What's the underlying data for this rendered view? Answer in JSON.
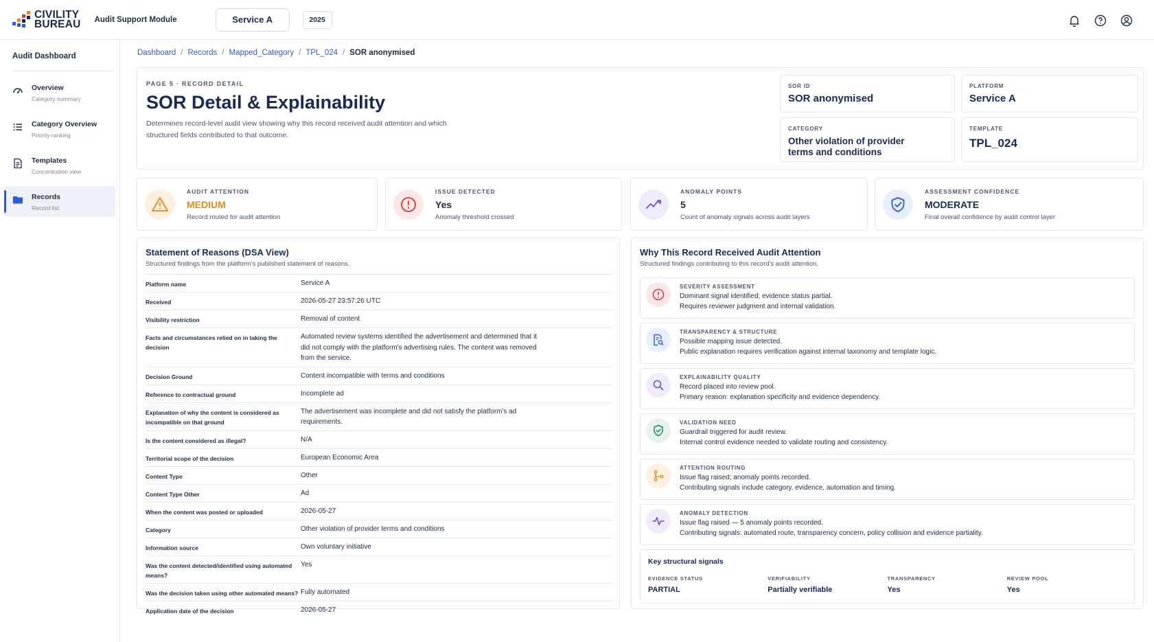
{
  "brand": {
    "line1": "CIVILITY",
    "line2": "BUREAU",
    "module": "Audit Support Module"
  },
  "topbar": {
    "service": "Service A",
    "year": "2025",
    "icons": [
      "bell-icon",
      "help-icon",
      "user-icon"
    ]
  },
  "sidebar": {
    "title": "Audit Dashboard",
    "items": [
      {
        "label": "Overview",
        "sub": "Category summary",
        "icon": "gauge-icon"
      },
      {
        "label": "Category Overview",
        "sub": "Priority ranking",
        "icon": "list-icon"
      },
      {
        "label": "Templates",
        "sub": "Concentration view",
        "icon": "document-icon"
      },
      {
        "label": "Records",
        "sub": "Record list",
        "icon": "folder-icon"
      }
    ]
  },
  "breadcrumb": [
    "Dashboard",
    "Records",
    "Mapped_Category",
    "TPL_024",
    "SOR anonymised"
  ],
  "header": {
    "eyebrow": "PAGE 5 · RECORD DETAIL",
    "title": "SOR Detail & Explainability",
    "description": "Determines record-level audit view showing why this record received audit attention and which structured fields contributed to that outcome.",
    "meta": {
      "sor_id_label": "SOR ID",
      "sor_id": "SOR anonymised",
      "platform_label": "PLATFORM",
      "platform": "Service A",
      "category_label": "CATEGORY",
      "category": "Other violation of provider terms and conditions",
      "template_label": "TEMPLATE",
      "template": "TPL_024"
    }
  },
  "stats": [
    {
      "label": "AUDIT ATTENTION",
      "value": "MEDIUM",
      "desc": "Record routed for audit attention",
      "icon": "warning-icon",
      "color": "#e58a1f"
    },
    {
      "label": "ISSUE DETECTED",
      "value": "Yes",
      "desc": "Anomaly threshold crossed",
      "icon": "alert-circle-icon",
      "color": "#d23b3b"
    },
    {
      "label": "ANOMALY POINTS",
      "value": "5",
      "desc": "Count of anomaly signals across audit layers",
      "icon": "trend-icon",
      "color": "#6b4fcf"
    },
    {
      "label": "ASSESSMENT CONFIDENCE",
      "value": "MODERATE",
      "desc": "Final overall confidence by audit control layer",
      "icon": "shield-check-icon",
      "color": "#2d5bd2"
    }
  ],
  "sor": {
    "title": "Statement of Reasons (DSA View)",
    "subtitle": "Structured findings from the platform's published statement of reasons.",
    "rows": [
      {
        "k": "Platform name",
        "v": "Service A"
      },
      {
        "k": "Received",
        "v": "2026-05-27 23:57:26 UTC"
      },
      {
        "k": "Visibility restriction",
        "v": "Removal of content"
      },
      {
        "k": "Facts and circumstances relied on in taking the decision",
        "v": "Automated review systems identified the advertisement and determined that it did not comply with the platform's advertising rules. The content was removed from the service."
      },
      {
        "k": "Decision Ground",
        "v": "Content incompatible with terms and conditions"
      },
      {
        "k": "Reference to contractual ground",
        "v": "Incomplete ad"
      },
      {
        "k": "Explanation of why the content is considered as incompatible on that ground",
        "v": "The advertisement was incomplete and did not satisfy the platform's ad requirements."
      },
      {
        "k": "Is the content considered as illegal?",
        "v": "N/A"
      },
      {
        "k": "Territorial scope of the decision",
        "v": "European Economic Area"
      },
      {
        "k": "Content Type",
        "v": "Other"
      },
      {
        "k": "Content Type Other",
        "v": "Ad"
      },
      {
        "k": "When the content was posted or uploaded",
        "v": "2026-05-27"
      },
      {
        "k": "Category",
        "v": "Other violation of provider terms and conditions"
      },
      {
        "k": "Information source",
        "v": "Own voluntary initiative"
      },
      {
        "k": "Was the content detected/identified using automated means?",
        "v": "Yes"
      },
      {
        "k": "Was the decision taken using other automated means?",
        "v": "Fully automated"
      },
      {
        "k": "Application date of the decision",
        "v": "2026-05-27"
      }
    ]
  },
  "why": {
    "title": "Why This Record Received Audit Attention",
    "subtitle": "Structured findings contributing to this record's audit attention.",
    "findings": [
      {
        "label": "SEVERITY ASSESSMENT",
        "line1": "Dominant signal identified; evidence status partial.",
        "line2": "Requires reviewer judgment and internal validation.",
        "icon": "alert-circle-icon",
        "color": "#d23b3b"
      },
      {
        "label": "TRANSPARENCY & STRUCTURE",
        "line1": "Possible mapping issue detected.",
        "line2": "Public explanation requires verification against internal taxonomy and template logic.",
        "icon": "document-search-icon",
        "color": "#2d5bd2"
      },
      {
        "label": "EXPLAINABILITY QUALITY",
        "line1": "Record placed into review pool.",
        "line2": "Primary reason: explanation specificity and evidence dependency.",
        "icon": "search-icon",
        "color": "#6b4fcf"
      },
      {
        "label": "VALIDATION NEED",
        "line1": "Guardrail triggered for audit review.",
        "line2": "Internal control evidence needed to validate routing and consistency.",
        "icon": "shield-check-icon",
        "color": "#1f8a5b"
      },
      {
        "label": "ATTENTION ROUTING",
        "line1": "Issue flag raised; anomaly points recorded.",
        "line2": "Contributing signals include category, evidence, automation and timing.",
        "icon": "route-icon",
        "color": "#e58a1f"
      },
      {
        "label": "ANOMALY DETECTION",
        "line1": "Issue flag raised — 5 anomaly points recorded.",
        "line2": "Contributing signals: automated route, transparency concern, policy collision and evidence partiality.",
        "icon": "pulse-icon",
        "color": "#6b4fcf"
      }
    ],
    "signals": {
      "title": "Key structural signals",
      "items": [
        {
          "label": "EVIDENCE STATUS",
          "value": "PARTIAL"
        },
        {
          "label": "VERIFIABILITY",
          "value": "Partially verifiable"
        },
        {
          "label": "TRANSPARENCY",
          "value": "Yes"
        },
        {
          "label": "REVIEW POOL",
          "value": "Yes"
        }
      ]
    }
  }
}
